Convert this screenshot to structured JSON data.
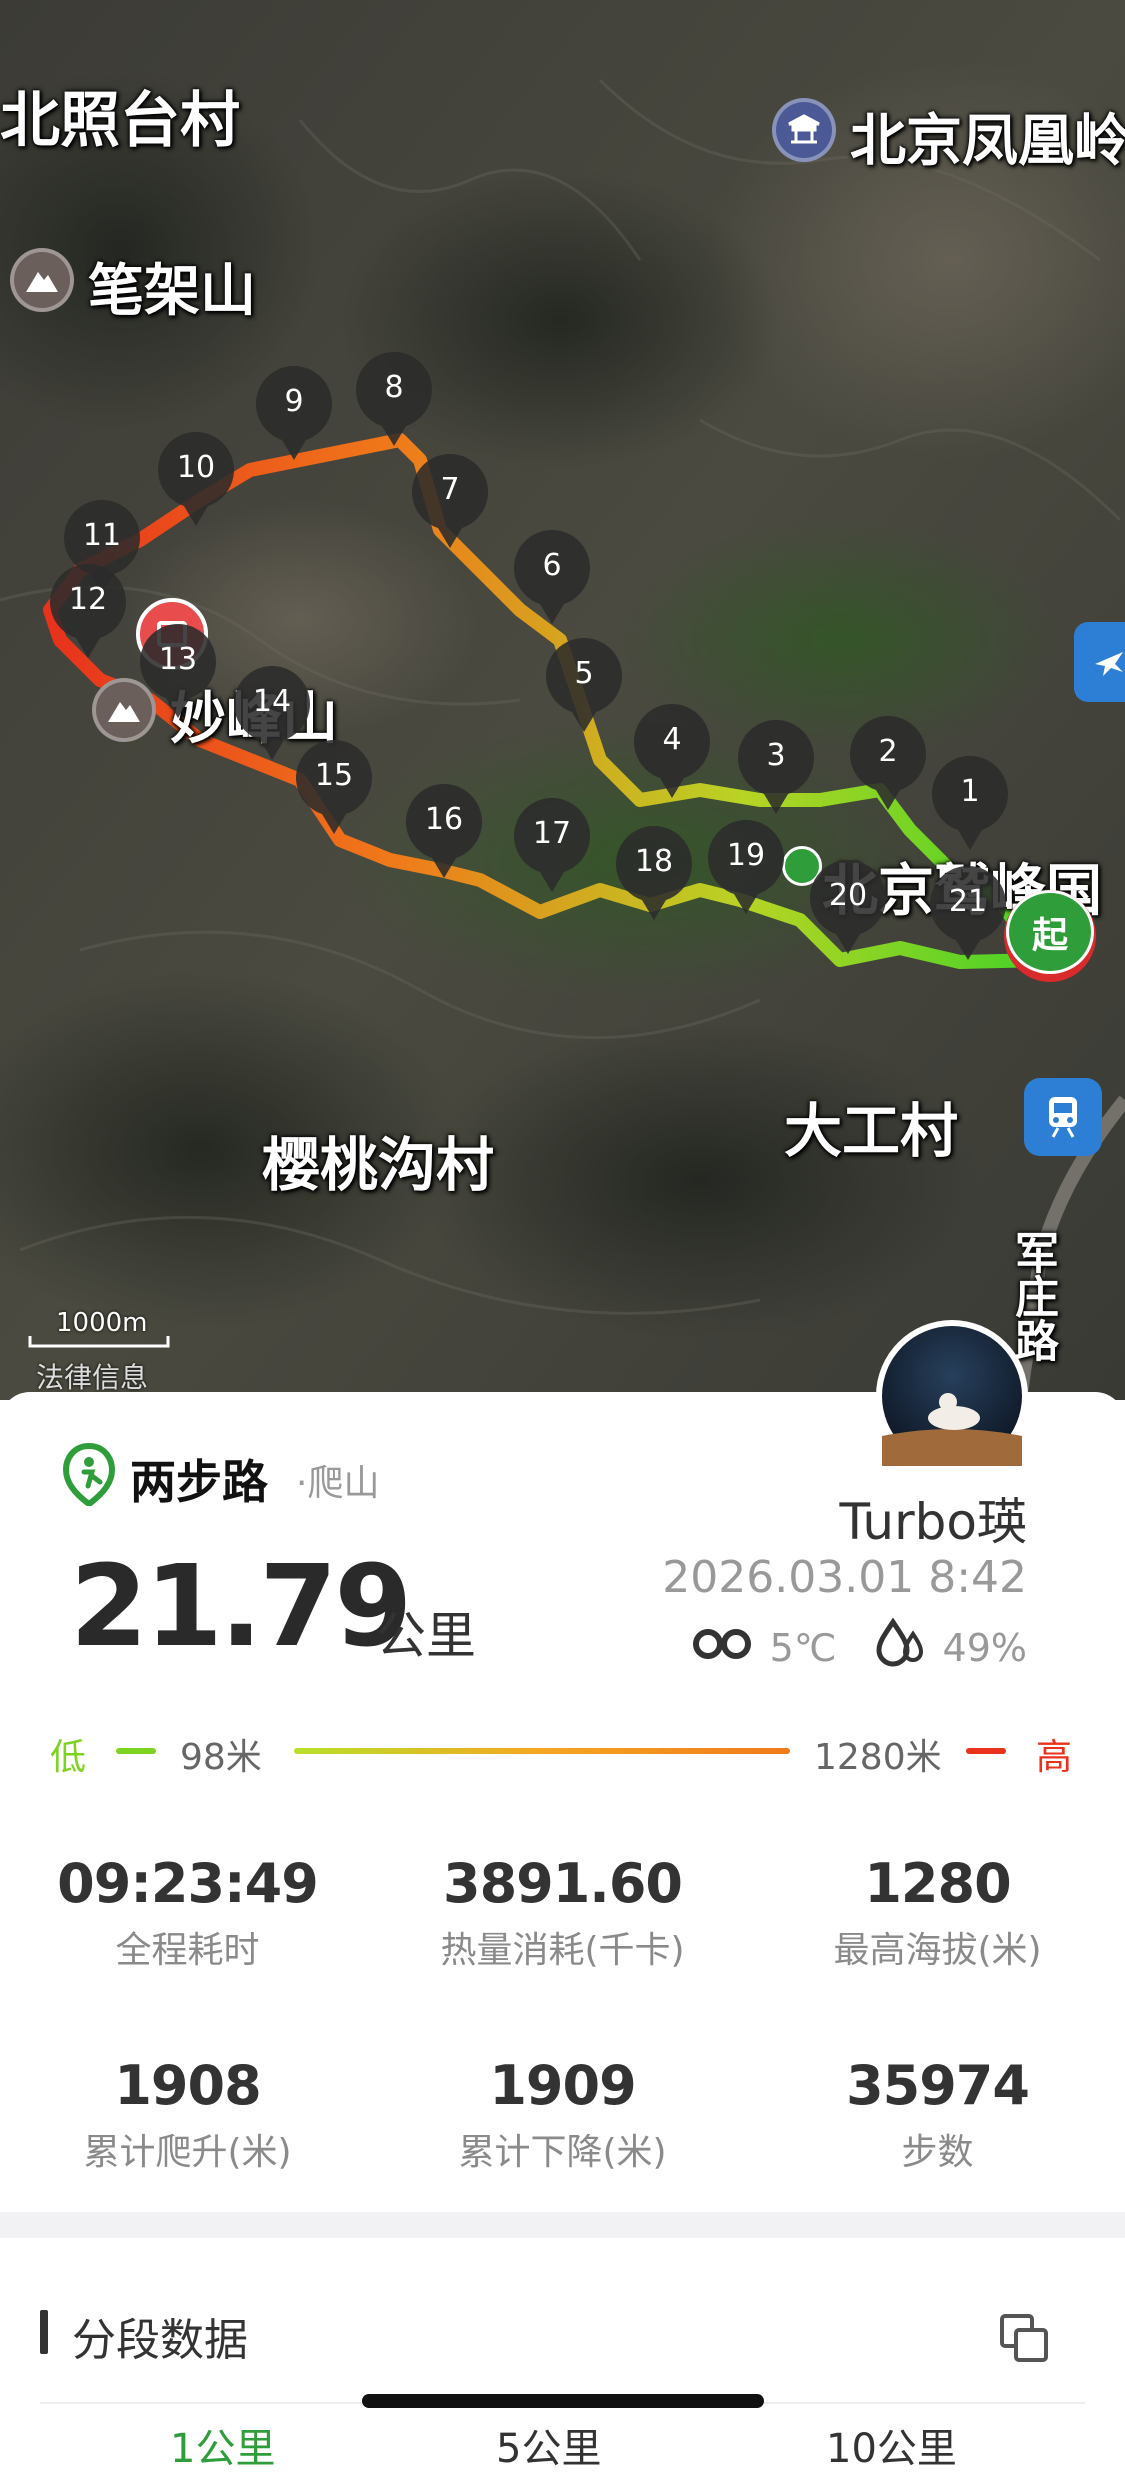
{
  "map": {
    "labels": {
      "village_north": "北照台村",
      "mountain_bijia": "笔架山",
      "scenic_phoenix": "北京凤凰岭",
      "mountain_miaofeng": "妙峰山",
      "scenic_jiufeng": "北京鹫峰国",
      "village_yingtao": "樱桃沟村",
      "village_dagong": "大工村",
      "road_name": "军庄路",
      "scale": "1000m",
      "legal": "法律信息"
    },
    "markers": [
      "1",
      "2",
      "3",
      "4",
      "5",
      "6",
      "7",
      "8",
      "9",
      "10",
      "11",
      "12",
      "13",
      "14",
      "15",
      "16",
      "17",
      "18",
      "19",
      "20",
      "21"
    ],
    "start_label": "起",
    "colors": {
      "low": "#7ed321",
      "mid": "#f5a623",
      "high": "#e8321c",
      "start_badge": "#2f9e3a"
    }
  },
  "card": {
    "brand": "两步路",
    "activity": "·爬山",
    "distance_value": "21.79",
    "distance_unit": "公里",
    "username": "Turbo瑛",
    "datetime": "2026.03.01 8:42",
    "temperature": "5℃",
    "humidity": "49%",
    "elevation": {
      "low_label": "低",
      "low_value": "98米",
      "high_value": "1280米",
      "high_label": "高"
    },
    "stats": [
      {
        "value": "09:23:49",
        "label": "全程耗时"
      },
      {
        "value": "3891.60",
        "label": "热量消耗(千卡)"
      },
      {
        "value": "1280",
        "label": "最高海拔(米)"
      },
      {
        "value": "1908",
        "label": "累计爬升(米)"
      },
      {
        "value": "1909",
        "label": "累计下降(米)"
      },
      {
        "value": "35974",
        "label": "步数"
      }
    ]
  },
  "segments": {
    "title": "分段数据",
    "tabs": [
      "1公里",
      "5公里",
      "10公里"
    ]
  }
}
